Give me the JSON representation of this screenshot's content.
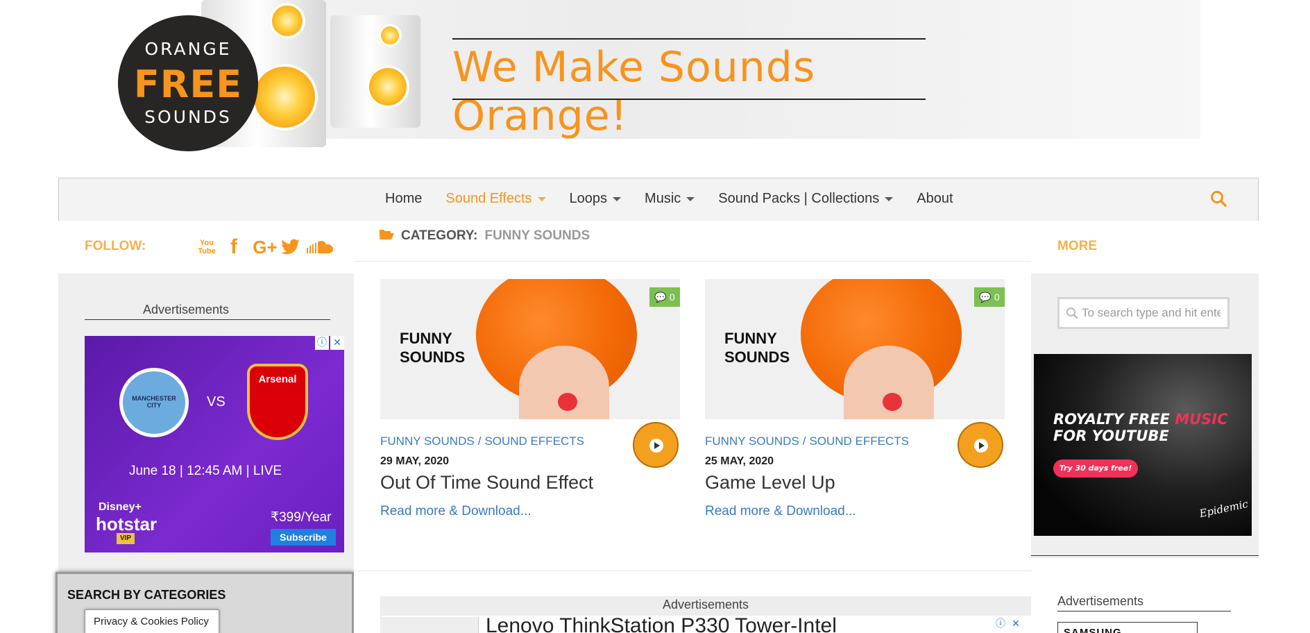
{
  "site": {
    "logo": {
      "line1": "ORANGE",
      "line2": "FREE",
      "line3": "SOUNDS"
    },
    "tagline": "We Make Sounds Orange!"
  },
  "nav": {
    "items": [
      {
        "label": "Home",
        "has_dropdown": false,
        "active": false
      },
      {
        "label": "Sound Effects",
        "has_dropdown": true,
        "active": true
      },
      {
        "label": "Loops",
        "has_dropdown": true,
        "active": false
      },
      {
        "label": "Music",
        "has_dropdown": true,
        "active": false
      },
      {
        "label": "Sound Packs | Collections",
        "has_dropdown": true,
        "active": false
      },
      {
        "label": "About",
        "has_dropdown": false,
        "active": false
      }
    ],
    "search_icon": "search-icon"
  },
  "left": {
    "follow_label": "FOLLOW:",
    "socials": [
      "youtube-icon",
      "facebook-icon",
      "google-plus-icon",
      "twitter-icon",
      "soundcloud-icon"
    ],
    "social_text": {
      "youtube_top": "You",
      "youtube_bottom": "Tube",
      "facebook": "f",
      "google_plus": "G+"
    },
    "adv_title": "Advertisements",
    "ad": {
      "team1": "MANCHESTER CITY",
      "vs": "VS",
      "team2": "Arsenal",
      "schedule": "June 18 | 12:45 AM | LIVE",
      "brand": "Disney+ hotstar",
      "brand_top": "Disney+",
      "brand_bottom": "hotstar",
      "tier": "VIP",
      "price": "₹399/Year",
      "cta": "Subscribe"
    },
    "categories_title": "SEARCH BY CATEGORIES",
    "privacy_label": "Privacy & Cookies Policy"
  },
  "main": {
    "category_prefix": "CATEGORY:",
    "category_name": "FUNNY SOUNDS",
    "posts": [
      {
        "thumb_text": [
          "FUNNY",
          "SOUNDS"
        ],
        "comments": "0",
        "cat1": "FUNNY SOUNDS",
        "cat2": "SOUND EFFECTS",
        "date": "29 MAY, 2020",
        "title": "Out Of Time Sound Effect",
        "read_more": "Read more & Download..."
      },
      {
        "thumb_text": [
          "FUNNY",
          "SOUNDS"
        ],
        "comments": "0",
        "cat1": "FUNNY SOUNDS",
        "cat2": "SOUND EFFECTS",
        "date": "25 MAY, 2020",
        "title": "Game Level Up",
        "read_more": "Read more & Download..."
      }
    ],
    "adv_title": "Advertisements",
    "lenovo_text": "Lenovo ThinkStation P330 Tower-Intel"
  },
  "right": {
    "more_label": "MORE",
    "search_placeholder": "To search type and hit enter",
    "ad": {
      "line1a": "ROYALTY FREE ",
      "line1b": "MUSIC",
      "line2": "FOR YOUTUBE",
      "cta": "Try 30 days free!",
      "brand": "Epidemic"
    },
    "adv_title": "Advertisements",
    "samsung_text": "SAMSUNG"
  },
  "colors": {
    "accent": "#f7941d",
    "link": "#3a7abf",
    "comment_badge": "#7cbf52"
  }
}
